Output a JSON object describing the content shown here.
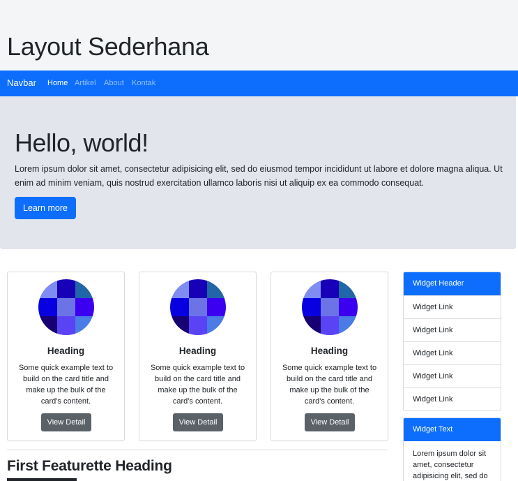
{
  "header": {
    "title": "Layout Sederhana"
  },
  "navbar": {
    "brand": "Navbar",
    "items": [
      {
        "label": "Home",
        "active": true
      },
      {
        "label": "Artikel",
        "active": false
      },
      {
        "label": "About",
        "active": false
      },
      {
        "label": "Kontak",
        "active": false
      }
    ]
  },
  "jumbotron": {
    "title": "Hello, world!",
    "text": "Lorem ipsum dolor sit amet, consectetur adipisicing elit, sed do eiusmod tempor incididunt ut labore et dolore magna aliqua. Ut enim ad minim veniam, quis nostrud exercitation ullamco laboris nisi ut aliquip ex ea commodo consequat.",
    "button_label": "Learn more"
  },
  "cards": [
    {
      "title": "Heading",
      "text": "Some quick example text to build on the card title and make up the bulk of the card's content.",
      "button_label": "View Detail"
    },
    {
      "title": "Heading",
      "text": "Some quick example text to build on the card title and make up the bulk of the card's content.",
      "button_label": "View Detail"
    },
    {
      "title": "Heading",
      "text": "Some quick example text to build on the card title and make up the bulk of the card's content.",
      "button_label": "View Detail"
    }
  ],
  "card_image_colors": [
    "#7f8cf2",
    "#1700b8",
    "#2166a6",
    "#0800e0",
    "#6b73e6",
    "#3a00ef",
    "#170073",
    "#5a43f5",
    "#4a7be6"
  ],
  "featurette": {
    "heading": "First Featurette Heading"
  },
  "widget_links": {
    "header": "Widget Header",
    "links": [
      "Widget Link",
      "Widget Link",
      "Widget Link",
      "Widget Link",
      "Widget Link"
    ]
  },
  "widget_text": {
    "header": "Widget Text",
    "body": "Lorem ipsum dolor sit amet, consectetur adipisicing elit, sed do"
  },
  "colors": {
    "primary": "#0d6efd",
    "secondary": "#5a6268",
    "jumbotron_bg": "#e2e5eb",
    "header_bg": "#f4f5f7"
  }
}
